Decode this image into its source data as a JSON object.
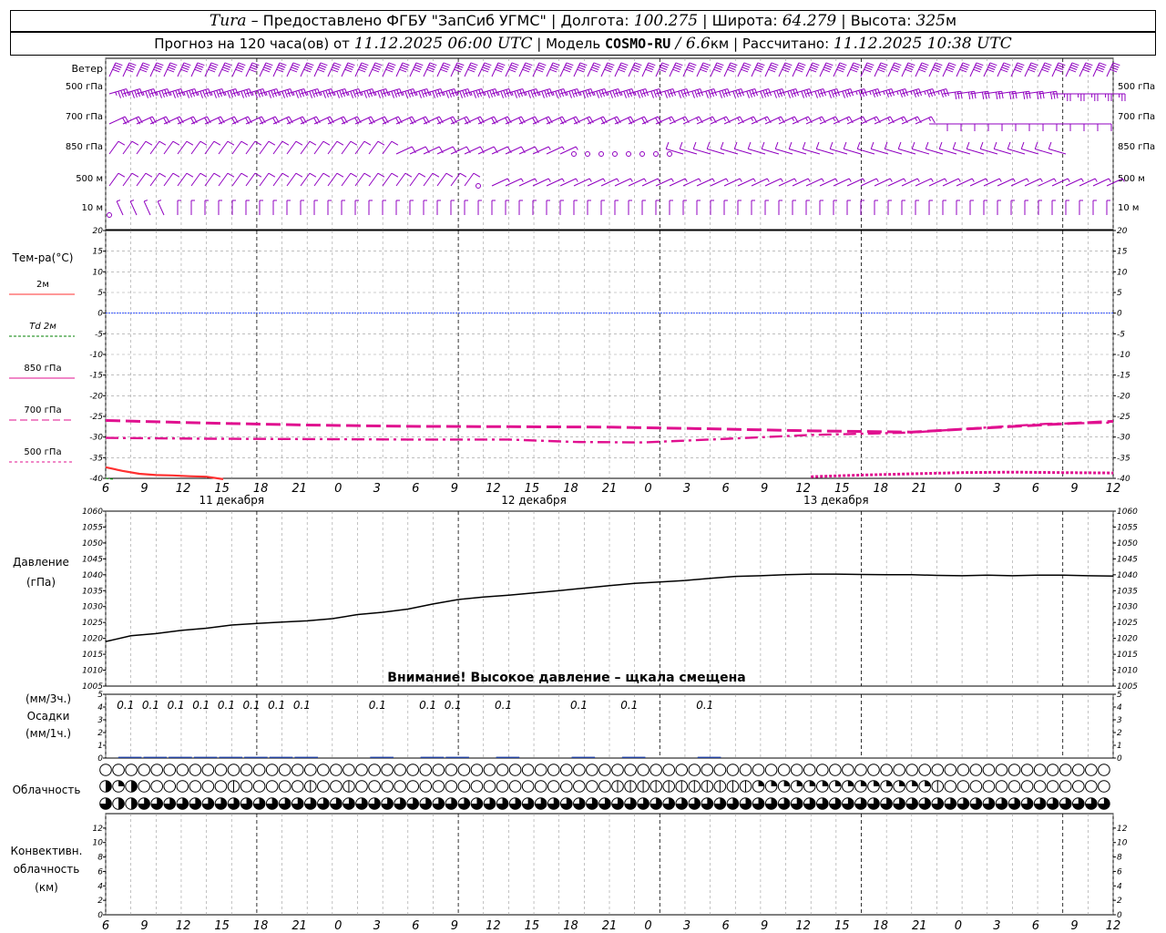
{
  "header": {
    "station": "Tura",
    "provider": " – Предоставлено ФГБУ \"ЗапСиб УГМС\" | Долгота: ",
    "lon": "100.275",
    "lat_label": " | Широта: ",
    "lat": "64.279",
    "alt_label": " | Высота: ",
    "alt": "325",
    "alt_unit": "м",
    "forecast_prefix": "Прогноз на 120 часа(ов) от ",
    "forecast_start": "11.12.2025 06:00 UTC",
    "model_label": " | Модель ",
    "model": "COSMO-RU",
    "res_sep": " / ",
    "resolution": "6.6",
    "res_unit": "км",
    "calc_label": " | Рассчитано: ",
    "calculated": "11.12.2025 10:38 UTC"
  },
  "wind_panel": {
    "title": "Ветер",
    "levels": [
      "500 гПа",
      "700 гПа",
      "850 гПа",
      "500 м",
      "10 м"
    ]
  },
  "temp_panel": {
    "title": "Тем-ра(°C)",
    "legend": [
      {
        "label": "2м",
        "color": "#ff3030",
        "dash": ""
      },
      {
        "label": "Td  2м",
        "color": "#008000",
        "dash": "3,2"
      },
      {
        "label": "850 гПа",
        "color": "#e0108f",
        "dash": ""
      },
      {
        "label": "700 гПа",
        "color": "#e0108f",
        "dash": "8,4"
      },
      {
        "label": "500 гПа",
        "color": "#e0108f",
        "dash": "3,3"
      }
    ]
  },
  "time_axis": {
    "hours": [
      "6",
      "9",
      "12",
      "15",
      "18",
      "21",
      "0",
      "3",
      "6",
      "9",
      "12",
      "15",
      "18",
      "21",
      "0",
      "3",
      "6",
      "9",
      "12",
      "15",
      "18",
      "21",
      "0",
      "3",
      "6",
      "9",
      "12"
    ],
    "dates": [
      "11 декабря",
      "12 декабря",
      "13 декабря"
    ]
  },
  "pressure_panel": {
    "title": "Давление",
    "unit": "(гПа)",
    "warning": "Внимание! Высокое давление – щкала смещена"
  },
  "precip_panel": {
    "unit1": "(мм/3ч.)",
    "title": "Осадки",
    "unit2": "(мм/1ч.)",
    "labels": [
      {
        "hour": 3,
        "text": "0.1"
      },
      {
        "hour": 6,
        "text": "0.1"
      },
      {
        "hour": 9,
        "text": "0.1"
      },
      {
        "hour": 12,
        "text": "0.1"
      },
      {
        "hour": 15,
        "text": "0.1"
      },
      {
        "hour": 18,
        "text": "0.1"
      },
      {
        "hour": 21,
        "text": "0.1"
      },
      {
        "hour": 24,
        "text": "0.1"
      },
      {
        "hour": 33,
        "text": "0.1"
      },
      {
        "hour": 39,
        "text": "0.1"
      },
      {
        "hour": 42,
        "text": "0.1"
      },
      {
        "hour": 48,
        "text": "0.1"
      },
      {
        "hour": 57,
        "text": "0.1"
      },
      {
        "hour": 63,
        "text": "0.1"
      },
      {
        "hour": 72,
        "text": "0.1"
      }
    ]
  },
  "cloud_panel": {
    "title": "Облачность"
  },
  "conv_panel": {
    "title1": "Конвективн.",
    "title2": "облачность",
    "unit": "(км)"
  },
  "chart_data": [
    {
      "type": "line",
      "title": "Тем-ра(°C)",
      "x_hours_from_start": true,
      "ylim": [
        -40,
        20
      ],
      "yticks": [
        20,
        15,
        10,
        5,
        0,
        -5,
        -10,
        -15,
        -20,
        -25,
        -30,
        -35,
        -40
      ],
      "series": [
        {
          "name": "2м",
          "points": [
            [
              0,
              -37.3
            ],
            [
              2,
              -38.2
            ],
            [
              4,
              -38.9
            ],
            [
              6,
              -39.2
            ],
            [
              8,
              -39.3
            ],
            [
              10,
              -39.5
            ],
            [
              12,
              -39.6
            ],
            [
              14,
              -40.2
            ]
          ]
        },
        {
          "name": "Td  2м",
          "points": [
            [
              0,
              -40
            ],
            [
              1,
              -40.2
            ]
          ]
        },
        {
          "name": "850 гПа",
          "points": [
            [
              0,
              -26.0
            ],
            [
              12,
              -26.6
            ],
            [
              24,
              -27.1
            ],
            [
              36,
              -27.4
            ],
            [
              48,
              -27.5
            ],
            [
              60,
              -27.6
            ],
            [
              72,
              -28.0
            ],
            [
              84,
              -28.5
            ],
            [
              96,
              -28.8
            ],
            [
              104,
              -27.9
            ],
            [
              112,
              -27.0
            ],
            [
              120,
              -26.2
            ]
          ]
        },
        {
          "name": "700 гПа",
          "points": [
            [
              0,
              -30.2
            ],
            [
              12,
              -30.4
            ],
            [
              24,
              -30.5
            ],
            [
              36,
              -30.6
            ],
            [
              48,
              -30.6
            ],
            [
              56,
              -31.2
            ],
            [
              64,
              -31.3
            ],
            [
              72,
              -30.6
            ],
            [
              84,
              -29.5
            ],
            [
              96,
              -28.9
            ],
            [
              104,
              -27.8
            ],
            [
              112,
              -26.8
            ],
            [
              120,
              -26.5
            ]
          ]
        },
        {
          "name": "500 гПа",
          "points": [
            [
              84,
              -39.6
            ],
            [
              90,
              -39.2
            ],
            [
              96,
              -38.9
            ],
            [
              102,
              -38.6
            ],
            [
              108,
              -38.5
            ],
            [
              114,
              -38.6
            ],
            [
              120,
              -38.7
            ]
          ]
        }
      ]
    },
    {
      "type": "line",
      "title": "Давление",
      "ylim": [
        1005,
        1060
      ],
      "yticks": [
        1060,
        1055,
        1050,
        1045,
        1040,
        1035,
        1030,
        1025,
        1020,
        1015,
        1010,
        1005
      ],
      "series": [
        {
          "name": "",
          "points": [
            [
              0,
              1019
            ],
            [
              3,
              1020.8
            ],
            [
              6,
              1021.5
            ],
            [
              9,
              1022.5
            ],
            [
              12,
              1023.2
            ],
            [
              15,
              1024.2
            ],
            [
              18,
              1024.7
            ],
            [
              21,
              1025.1
            ],
            [
              24,
              1025.5
            ],
            [
              27,
              1026.2
            ],
            [
              30,
              1027.5
            ],
            [
              33,
              1028.2
            ],
            [
              36,
              1029.2
            ],
            [
              39,
              1030.8
            ],
            [
              42,
              1032.2
            ],
            [
              45,
              1033.0
            ],
            [
              48,
              1033.6
            ],
            [
              51,
              1034.3
            ],
            [
              54,
              1035.0
            ],
            [
              57,
              1035.8
            ],
            [
              60,
              1036.6
            ],
            [
              63,
              1037.3
            ],
            [
              66,
              1037.7
            ],
            [
              69,
              1038.2
            ],
            [
              72,
              1038.9
            ],
            [
              75,
              1039.5
            ],
            [
              78,
              1039.7
            ],
            [
              81,
              1040.0
            ],
            [
              84,
              1040.2
            ],
            [
              87,
              1040.2
            ],
            [
              90,
              1040.1
            ],
            [
              93,
              1040.0
            ],
            [
              96,
              1040.0
            ],
            [
              99,
              1039.8
            ],
            [
              102,
              1039.7
            ],
            [
              105,
              1039.9
            ],
            [
              108,
              1039.7
            ],
            [
              111,
              1039.9
            ],
            [
              114,
              1039.9
            ],
            [
              117,
              1039.7
            ],
            [
              120,
              1039.6
            ]
          ]
        }
      ]
    },
    {
      "type": "bar",
      "title": "Осадки",
      "ylim": [
        0,
        5
      ],
      "yticks": [
        5,
        4,
        3,
        2,
        1,
        0
      ],
      "hours": [
        3,
        6,
        9,
        12,
        15,
        18,
        21,
        24,
        33,
        39,
        42,
        48,
        57,
        63,
        72
      ],
      "values": [
        0.1,
        0.1,
        0.1,
        0.1,
        0.1,
        0.1,
        0.1,
        0.1,
        0.1,
        0.1,
        0.1,
        0.1,
        0.1,
        0.1,
        0.1
      ]
    },
    {
      "type": "bar",
      "title": "Конвективн. облачность",
      "ylim": [
        0,
        13
      ],
      "yticks": [
        12,
        10,
        8,
        6,
        4,
        2,
        0
      ],
      "values": []
    }
  ],
  "cloud_data": {
    "high": "0000000000000000000000000000000000000000000000000000000000000000000000000000000000000000",
    "mid": "3230000000100000100100000000000000000000111111111112222222222222210000000000000000000000",
    "low": "4334444444444444444444444444444444444444444444444444444444444444444444444444444444444444"
  },
  "wind_data": {
    "500 гПа": "70:45|70:45|70:45|70:45|70:45|70:45|70:45|70:45|70:45|70:45|70:45|70:45|70:45|70:45|70:45|70:45|70:45|70:45|70:45|70:45|70:45|70:45|70:45|70:45|70:45|70:45|70:45|70:45|70:45|70:45|70:45|70:45|70:45|70:45|70:45|70:45|70:45|70:45|70:45|70:40|70:40|70:40|70:40|70:40|70:40|70:40|70:40|70:40|70:40|70:40|70:40|70:40|70:40|70:40|70:35|70:35|70:35|70:35|70:35|70:35|70:35|80:30|80:30|80:30|80:30|80:30|80:30|80:30|80:30|90:25|90:25|90:25|90:25|90:25",
    "700 гПа": "60:20|60:20|60:20|60:20|60:20|60:20|60:20|60:20|60:20|60:20|60:20|60:20|60:20|60:20|60:20|60:20|60:20|60:20|60:20|60:20|60:20|60:20|60:20|60:20|60:20|60:20|60:20|60:20|60:20|60:20|60:20|60:20|60:20|60:20|60:20|60:20|60:20|60:20|60:20|60:20|60:15|60:15|60:15|60:15|60:15|60:15|60:15|60:15|60:15|60:15|60:15|60:15|60:15|60:15|60:15|60:15|60:15|60:15|60:15|60:15|90:10|90:10|90:10|90:10|90:10|90:10|90:10|90:10|90:10|90:10|90:10|90:10|90:10",
    "850 гПа": "30:10|30:10|30:10|30:10|30:10|30:10|30:10|30:10|30:10|30:10|30:10|30:10|30:10|30:10|30:10|30:10|30:10|30:10|30:10|30:10|30:10|60:10|60:10|60:10|60:10|60:10|60:10|60:10|60:10|60:10|60:10|60:5|60:5|60:5|0:0|0:0|0:0|0:0|0:0|0:0|0:0|0:0|290:10|290:10|290:10|290:10|290:10|290:10|290:10|290:10|290:10|290:10|290:10|290:10|290:10|290:10|290:10|290:10|290:10|290:10|290:10|290:10|290:10|290:10|290:10|290:10|290:10|290:10|290:10|290:10|290:10",
    "500 м": "30:10|30:10|30:10|30:10|30:10|30:10|30:10|30:10|30:10|30:10|30:10|30:10|30:10|30:10|30:10|30:10|30:10|30:10|30:10|30:10|30:10|30:10|30:10|30:10|30:10|30:10|30:10|0:0|60:5|60:5|60:5|60:5|60:5|60:5|60:5|60:5|60:5|60:5|60:5|60:5|60:5|60:5|60:5|60:5|60:5|60:5|60:5|60:5|60:5|60:5|60:5|60:5|60:5|60:5|60:5|60:5|60:5|60:5|60:5|60:5|60:5|60:5|60:5|60:5|60:5|60:5|60:5|60:5|60:5|60:5|60:5|60:5|60:5|60:5",
    "10 м": "0:0|340:5|340:5|340:5|340:5|0:5|0:5|0:5|0:5|0:5|0:5|0:5|0:5|0:5|0:5|0:5|0:5|0:5|0:5|0:5|0:5|0:5|0:5|0:5|0:5|0:5|0:5|0:5|0:5|0:5|0:5|0:5|0:5|0:5|0:5|0:5|0:5|0:5|0:5|0:5|0:5|0:5|0:5|0:5|0:5|0:5|0:5|0:5|0:5|0:5|0:5|0:5|0:5|0:5|0:5|0:5|0:5|0:5|0:5|0:5|0:5|0:5|0:5|0:5|0:5|0:5|0:5|0:5|0:5|0:5|0:5|0:5|0:5|0:5|0:5|0:5"
  },
  "colors": {
    "wind": "#9000c0",
    "zero_line": "#3050ff",
    "grid": "#999999",
    "precip": "#2040a0"
  }
}
